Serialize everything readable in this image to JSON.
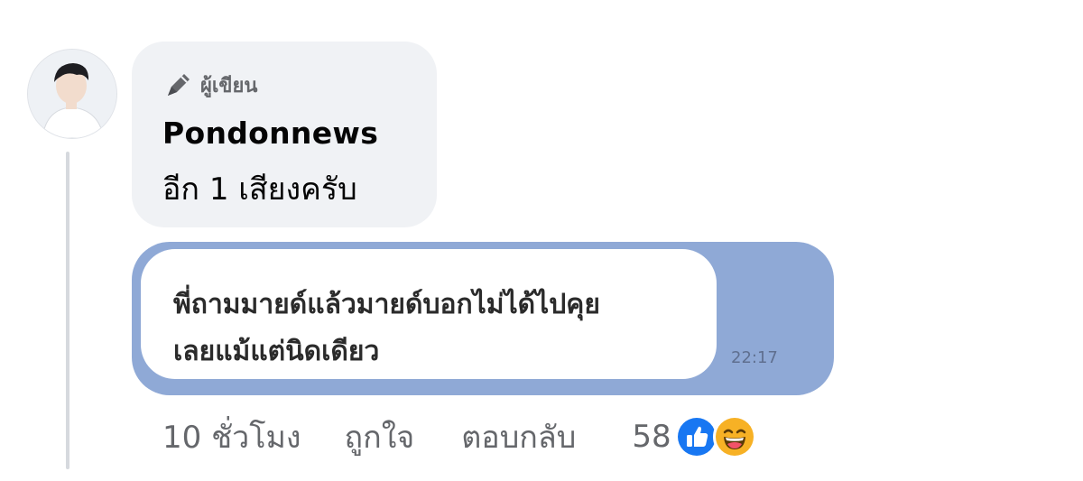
{
  "comment": {
    "avatar_icon": "profile-photo-avatar",
    "badge_icon": "pen-icon",
    "badge_label": "ผู้เขียน",
    "author_name": "Pondonnews",
    "text": "อีก 1 เสียงครับ"
  },
  "attachment": {
    "message_lines": [
      "พี่ถามมายด์แล้วมายด์บอกไม่ได้ไปคุย",
      "เลยแม้แต่นิดเดียว"
    ],
    "timestamp": "22:17",
    "background_color": "#8fa9d6"
  },
  "actions": {
    "time_ago": "10 ชั่วโมง",
    "like_label": "ถูกใจ",
    "reply_label": "ตอบกลับ",
    "reaction_count": "58",
    "reaction_icons": [
      "like-reaction-icon",
      "haha-reaction-icon"
    ]
  },
  "colors": {
    "bubble_bg": "#f0f2f5",
    "secondary_text": "#65676b",
    "like_blue": "#1877f2",
    "haha_yellow": "#f7b125"
  }
}
